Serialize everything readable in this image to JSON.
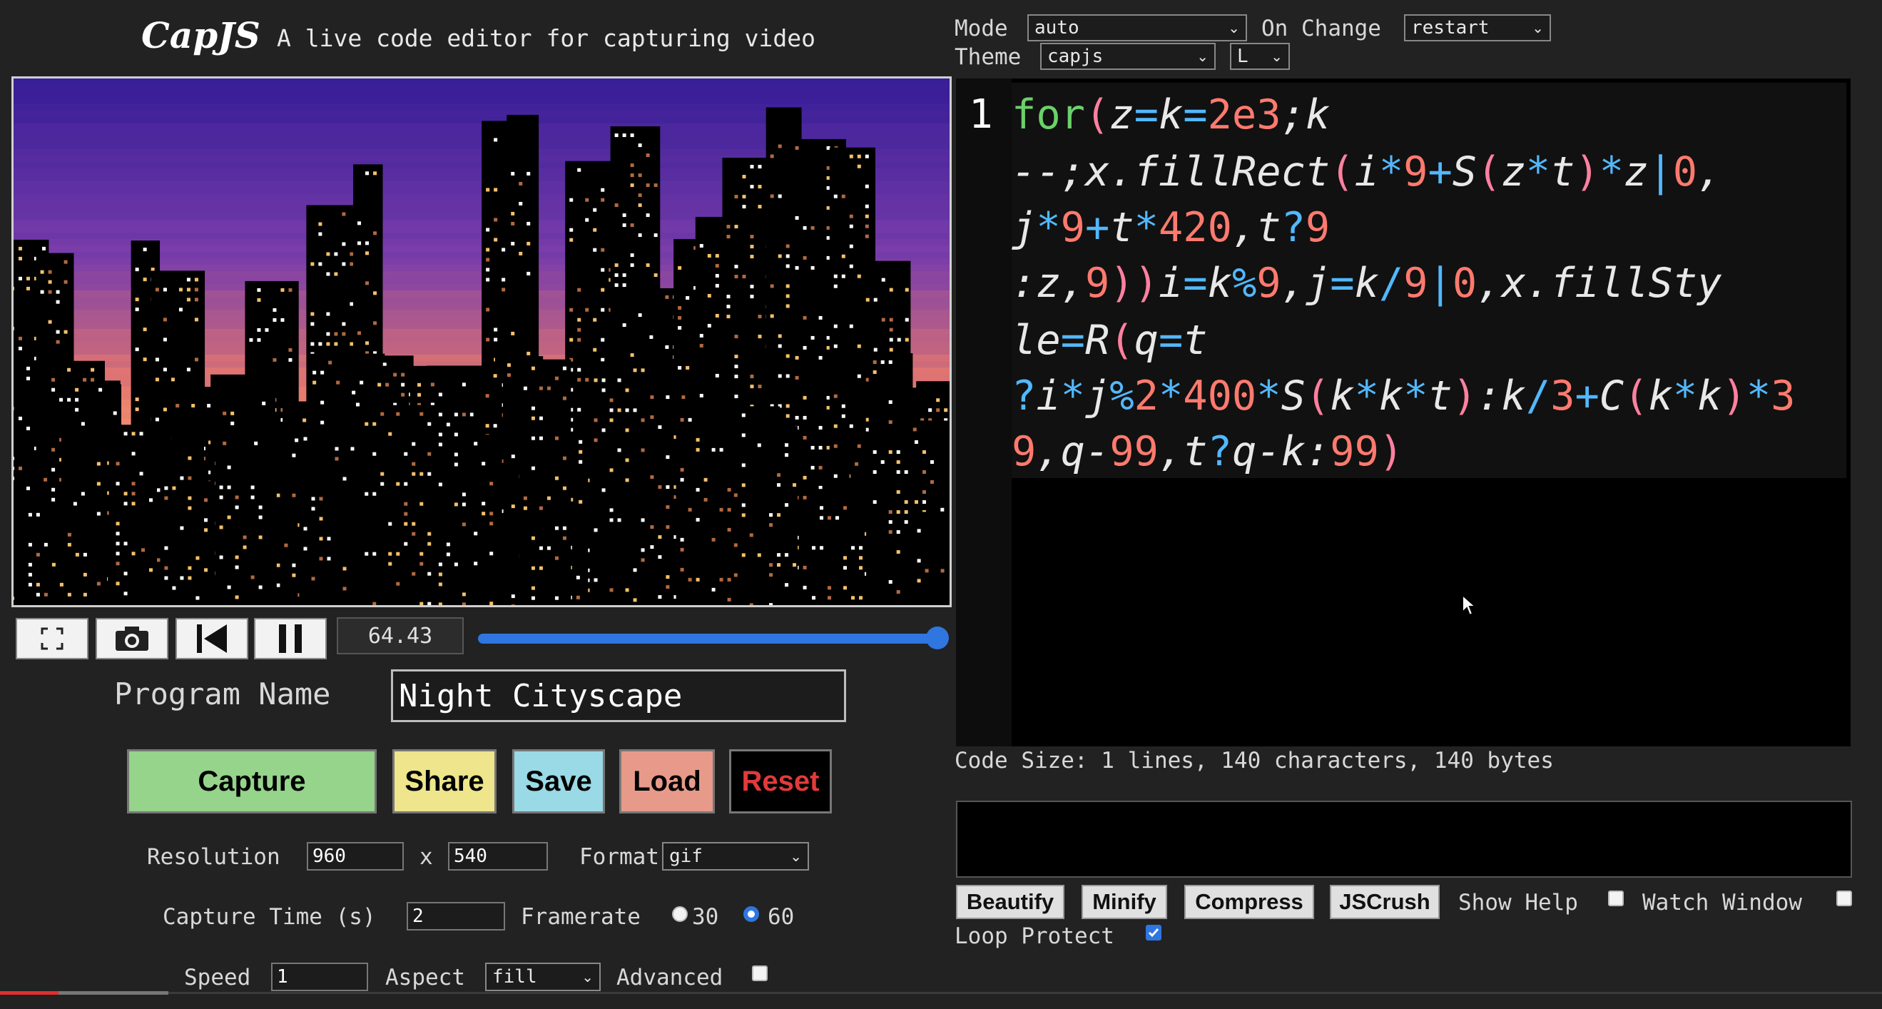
{
  "header": {
    "logo": "CapJS",
    "tagline": "A live code editor for capturing video"
  },
  "transport": {
    "time": "64.43",
    "progress": 1.0
  },
  "program": {
    "label": "Program Name",
    "value": "Night Cityscape"
  },
  "actions": {
    "capture": "Capture",
    "share": "Share",
    "save": "Save",
    "load": "Load",
    "reset": "Reset"
  },
  "settings": {
    "resolution_label": "Resolution",
    "width": "960",
    "x": "x",
    "height": "540",
    "format_label": "Format",
    "format": "gif",
    "capture_time_label": "Capture Time (s)",
    "capture_time": "2",
    "framerate_label": "Framerate",
    "fps_30": "30",
    "fps_60": "60",
    "speed_label": "Speed",
    "speed": "1",
    "aspect_label": "Aspect",
    "aspect": "fill",
    "advanced_label": "Advanced"
  },
  "editor_toolbar": {
    "mode_label": "Mode",
    "mode": "auto",
    "on_change_label": "On Change",
    "on_change": "restart",
    "theme_label": "Theme",
    "theme": "capjs",
    "size": "L"
  },
  "editor": {
    "line_number": "1",
    "code": "for(z=k=2e3;k--;x.fillRect(i*9+S(z*t)*z|0,j*9+t*420,t?9:z,9))i=k%9,j=k/9|0,x.fillStyle=R(q=t?i*j%2*400*S(k*k*t):k/3+C(k*k)*39,q-99,t?q-k:99)"
  },
  "code_size": "Code Size: 1 lines, 140 characters, 140 bytes",
  "tools": {
    "beautify": "Beautify",
    "minify": "Minify",
    "compress": "Compress",
    "jscrush": "JSCrush",
    "show_help": "Show Help",
    "watch_window": "Watch Window",
    "loop_protect": "Loop Protect"
  },
  "colors": {
    "capture": "#95d48a",
    "share": "#eee58c",
    "save": "#9ad9e6",
    "load": "#e89a8a",
    "reset_text": "#e23a3a",
    "accent": "#2f76e0"
  }
}
